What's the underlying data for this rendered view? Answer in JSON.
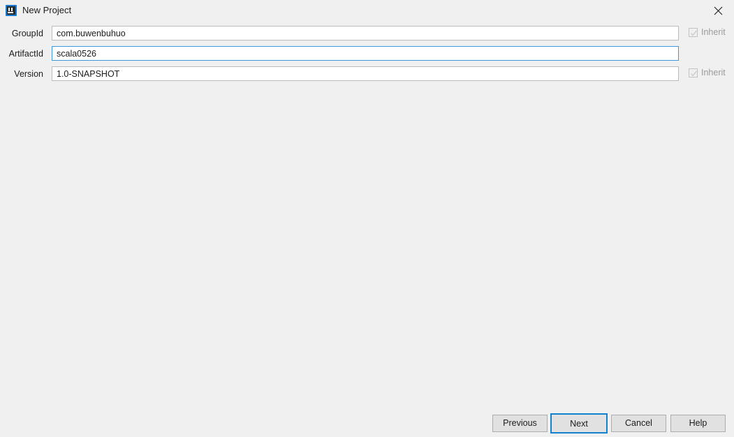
{
  "window": {
    "title": "New Project",
    "icon": "intellij-idea-icon",
    "close_icon": "close-icon",
    "background_color": "#f0f0f0"
  },
  "form": {
    "rows": [
      {
        "label": "GroupId",
        "value": "com.buwenbuhuo",
        "focused": false,
        "inherit": {
          "label": "Inherit",
          "checked": true,
          "enabled": false
        }
      },
      {
        "label": "ArtifactId",
        "value": "scala0526",
        "focused": true,
        "inherit": null
      },
      {
        "label": "Version",
        "value": "1.0-SNAPSHOT",
        "focused": false,
        "inherit": {
          "label": "Inherit",
          "checked": true,
          "enabled": false
        }
      }
    ]
  },
  "footer": {
    "previous_label": "Previous",
    "next_label": "Next",
    "cancel_label": "Cancel",
    "help_label": "Help",
    "focus_color": "#1382ce"
  }
}
